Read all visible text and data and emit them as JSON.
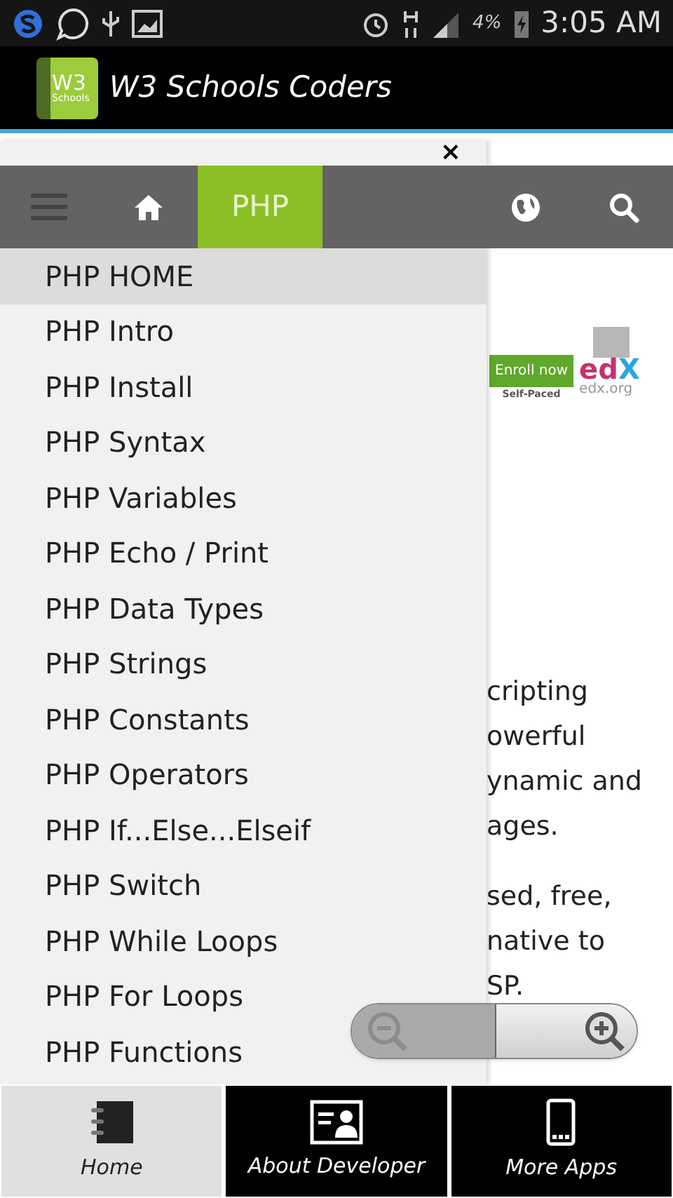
{
  "status_bar": {
    "battery": "4%",
    "time": "3:05 AM"
  },
  "app_bar": {
    "logo_top": "W3",
    "logo_bottom": "Schools",
    "title": "W3 Schools Coders"
  },
  "menu_close": "×",
  "nav": {
    "tabs": [
      {
        "kind": "menu",
        "selected": false
      },
      {
        "kind": "home",
        "selected": false
      },
      {
        "kind": "text",
        "label": "PHP",
        "selected": true
      },
      {
        "kind": "globe",
        "selected": false
      },
      {
        "kind": "search",
        "selected": false
      }
    ]
  },
  "menu": {
    "items": [
      {
        "label": "PHP HOME",
        "selected": true
      },
      {
        "label": "PHP Intro",
        "selected": false
      },
      {
        "label": "PHP Install",
        "selected": false
      },
      {
        "label": "PHP Syntax",
        "selected": false
      },
      {
        "label": "PHP Variables",
        "selected": false
      },
      {
        "label": "PHP Echo / Print",
        "selected": false
      },
      {
        "label": "PHP Data Types",
        "selected": false
      },
      {
        "label": "PHP Strings",
        "selected": false
      },
      {
        "label": "PHP Constants",
        "selected": false
      },
      {
        "label": "PHP Operators",
        "selected": false
      },
      {
        "label": "PHP If...Else...Elseif",
        "selected": false
      },
      {
        "label": "PHP Switch",
        "selected": false
      },
      {
        "label": "PHP While Loops",
        "selected": false
      },
      {
        "label": "PHP For Loops",
        "selected": false
      },
      {
        "label": "PHP Functions",
        "selected": false
      }
    ]
  },
  "ad": {
    "button": "Enroll now",
    "caption": "Self-Paced",
    "brand_a": "ed",
    "brand_b": "X",
    "domain": "edx.org"
  },
  "content": {
    "paragraphs": [
      [
        "cripting",
        "owerful",
        "ynamic and",
        "ages."
      ],
      [
        "sed, free,",
        "native to",
        "SP."
      ]
    ]
  },
  "bottom_tabs": [
    {
      "label": "Home",
      "kind": "notebook",
      "selected": true
    },
    {
      "label": "About Developer",
      "kind": "card",
      "selected": false
    },
    {
      "label": "More Apps",
      "kind": "phone",
      "selected": false
    }
  ]
}
